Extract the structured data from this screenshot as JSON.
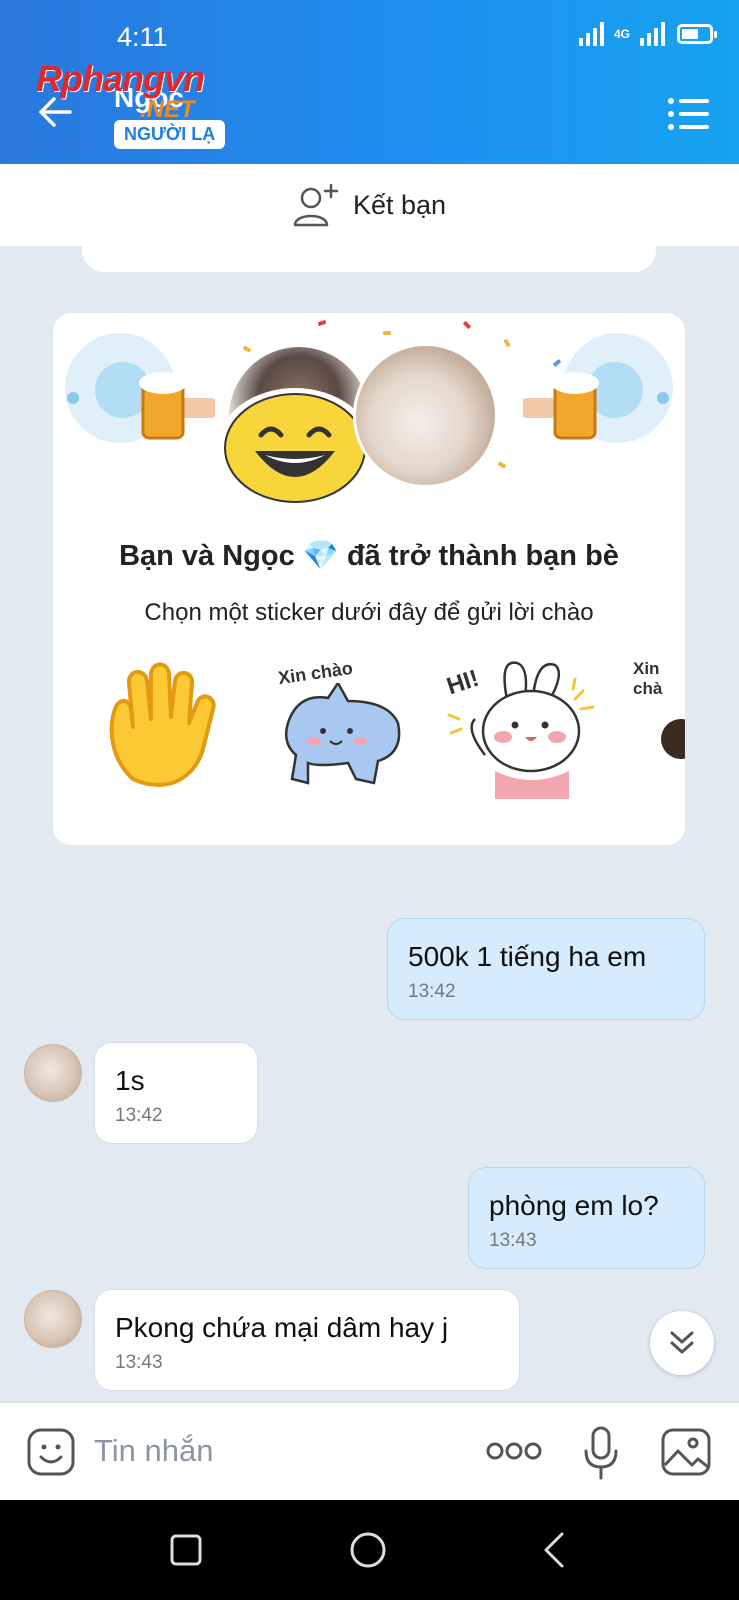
{
  "status_bar": {
    "time": "4:11",
    "network": "4G"
  },
  "header": {
    "contact_name": "Ngọc",
    "badge": "NGƯỜI LẠ",
    "watermark": "Rphangvn",
    "watermark_suffix": ".NET"
  },
  "add_friend": {
    "label": "Kết bạn"
  },
  "friend_card": {
    "title": "Bạn và Ngọc 💎 đã trở thành bạn bè",
    "subtitle": "Chọn một sticker dưới đây để gửi lời chào",
    "stickers": [
      {
        "icon": "waving-hand-sticker"
      },
      {
        "icon": "cat-sticker",
        "text": "Xin chào"
      },
      {
        "icon": "bunny-sticker",
        "text": "HI!"
      },
      {
        "icon": "partial-sticker",
        "text": "Xin chà"
      }
    ]
  },
  "messages": [
    {
      "direction": "out",
      "text": "500k 1 tiếng ha em",
      "time": "13:42"
    },
    {
      "direction": "in",
      "text": "1s",
      "time": "13:42"
    },
    {
      "direction": "out",
      "text": "phòng em lo?",
      "time": "13:43"
    },
    {
      "direction": "in",
      "text": "Pkong chứa mại dâm hay j",
      "time": "13:43"
    }
  ],
  "input": {
    "placeholder": "Tin nhắn"
  },
  "colors": {
    "header_start": "#2a78dd",
    "header_end": "#16a3f0",
    "outgoing_bubble": "#d6ebfb",
    "background": "#e2e9f1"
  }
}
